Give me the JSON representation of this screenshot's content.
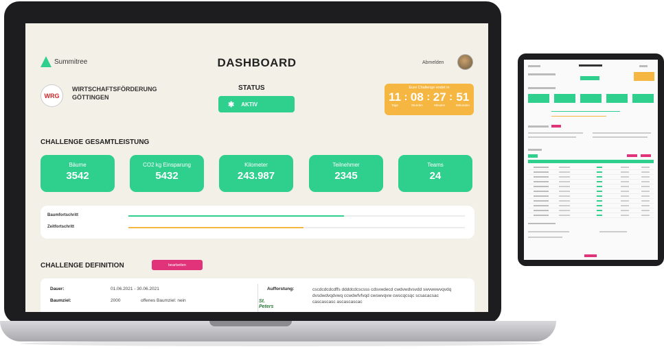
{
  "app": {
    "logo_text": "Summitree",
    "title": "DASHBOARD",
    "user_name": "Abmelden"
  },
  "org": {
    "logo_text": "WRG",
    "name_line1": "WIRTSCHAFTSFÖRDERUNG",
    "name_line2": "GÖTTINGEN"
  },
  "status": {
    "label": "STATUS",
    "value": "AKTIV"
  },
  "countdown": {
    "title": "Eure Challenge endet in",
    "days": "11",
    "hours": "08",
    "minutes": "27",
    "seconds": "51",
    "days_label": "Tage",
    "hours_label": "Stunden",
    "minutes_label": "Minuten",
    "seconds_label": "Sekunden"
  },
  "performance": {
    "title": "CHALLENGE GESAMTLEISTUNG",
    "stats": [
      {
        "label": "Bäume",
        "value": "3542"
      },
      {
        "label": "CO2 kg Einsparung",
        "value": "5432"
      },
      {
        "label": "Kilometer",
        "value": "243.987"
      },
      {
        "label": "Teilnehmer",
        "value": "2345"
      },
      {
        "label": "Teams",
        "value": "24"
      }
    ],
    "progress": [
      {
        "label": "Baumfortschritt",
        "fraction": 0.64,
        "color": "#2fcf8e"
      },
      {
        "label": "Zeitfortschritt",
        "fraction": 0.52,
        "color": "#f6b742"
      }
    ]
  },
  "definition": {
    "title": "CHALLENGE DEFINITION",
    "edit_label": "bearbeiten",
    "duration_label": "Dauer:",
    "duration_value": "01.06.2021 - 30.06.2021",
    "tree_goal_label": "Baumziel:",
    "tree_goal_value": "2000",
    "tree_goal_note": "offenes Baumziel: nein",
    "reforest_label": "Aufforstung:",
    "reforest_text": "cscdcdcdcdffs ddddcdcscsss cdsvwdecd cwdvwdvsvdd swvwvwvqvdq dvsdwdvqdvwq ccwdwfvfvqd cwswvqvw cwscqcsqc scsacacsac cascascasc ascascascac",
    "sponsor_logo_text": "St. Peters"
  },
  "colors": {
    "accent_green": "#2fcf8e",
    "accent_orange": "#f6b742",
    "accent_pink": "#e0337a",
    "screen_bg": "#f3f1e7"
  }
}
